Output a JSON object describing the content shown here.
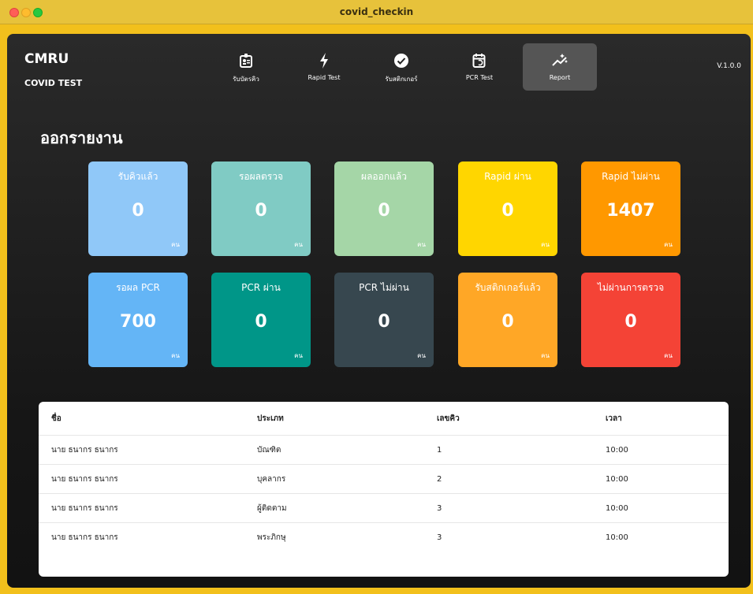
{
  "window": {
    "title": "covid_checkin"
  },
  "brand": {
    "line1": "CMRU",
    "line2": "COVID TEST"
  },
  "version": "V.1.0.0",
  "nav": [
    {
      "label": "รับบัตรคิว",
      "icon": "id-card-icon"
    },
    {
      "label": "Rapid Test",
      "icon": "lightning-icon"
    },
    {
      "label": "รับสติกเกอร์",
      "icon": "check-circle-icon"
    },
    {
      "label": "PCR Test",
      "icon": "calendar-refresh-icon"
    },
    {
      "label": "Report",
      "icon": "sparkle-chart-icon"
    }
  ],
  "page": {
    "title": "ออกรายงาน"
  },
  "cards": [
    {
      "title": "รับคิวแล้ว",
      "value": "0",
      "unit": "คน",
      "color": "#90c8f8"
    },
    {
      "title": "รอผลตรวจ",
      "value": "0",
      "unit": "คน",
      "color": "#80cbc4"
    },
    {
      "title": "ผลออกแล้ว",
      "value": "0",
      "unit": "คน",
      "color": "#a5d6a7"
    },
    {
      "title": "Rapid ผ่าน",
      "value": "0",
      "unit": "คน",
      "color": "#ffd600"
    },
    {
      "title": "Rapid ไม่ผ่าน",
      "value": "1407",
      "unit": "คน",
      "color": "#ff9800"
    },
    {
      "title": "รอผล PCR",
      "value": "700",
      "unit": "คน",
      "color": "#64b5f6"
    },
    {
      "title": "PCR ผ่าน",
      "value": "0",
      "unit": "คน",
      "color": "#009688"
    },
    {
      "title": "PCR ไม่ผ่าน",
      "value": "0",
      "unit": "คน",
      "color": "#37474f"
    },
    {
      "title": "รับสติกเกอร์แล้ว",
      "value": "0",
      "unit": "คน",
      "color": "#ffa726"
    },
    {
      "title": "ไม่ผ่านการตรวจ",
      "value": "0",
      "unit": "คน",
      "color": "#f44336"
    }
  ],
  "table": {
    "headers": [
      "ชื่อ",
      "ประเภท",
      "เลขคิว",
      "เวลา"
    ],
    "rows": [
      [
        "นาย ธนากร ธนากร",
        "บัณฑิต",
        "1",
        "10:00"
      ],
      [
        "นาย ธนากร ธนากร",
        "บุคลากร",
        "2",
        "10:00"
      ],
      [
        "นาย ธนากร ธนากร",
        "ผู้ติดตาม",
        "3",
        "10:00"
      ],
      [
        "นาย ธนากร ธนากร",
        "พระภิกษุ",
        "3",
        "10:00"
      ]
    ]
  }
}
